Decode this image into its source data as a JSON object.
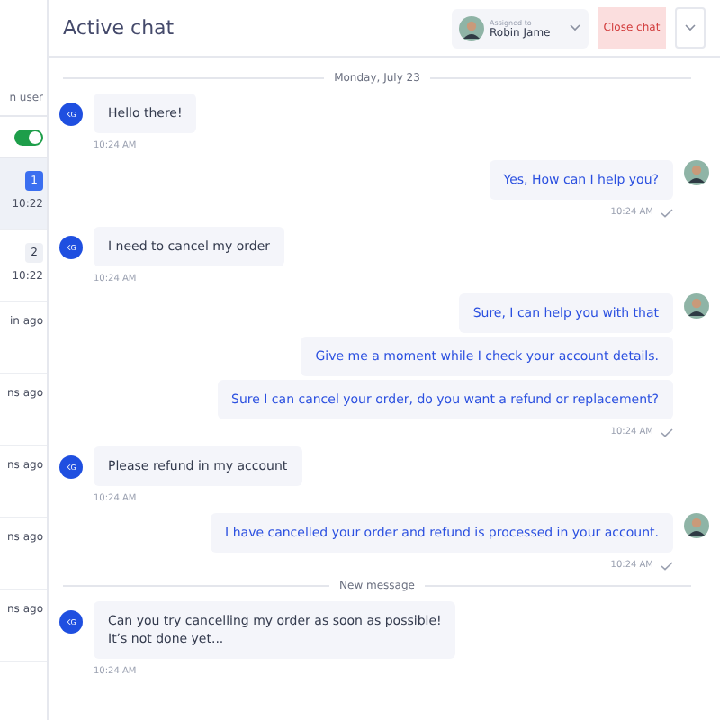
{
  "sidebar": {
    "filter_label": "n user",
    "toggle": {
      "on": true
    },
    "items": [
      {
        "badge": "1",
        "time": "10:22",
        "selected": true
      },
      {
        "badge": "2",
        "time": "10:22",
        "selected": false
      },
      {
        "time": "in ago",
        "selected": false
      },
      {
        "time": "ns ago",
        "selected": false
      },
      {
        "time": "ns ago",
        "selected": false
      },
      {
        "time": "ns ago",
        "selected": false
      },
      {
        "time": "ns ago",
        "selected": false
      }
    ]
  },
  "header": {
    "title": "Active chat",
    "assigned_label": "Assigned to",
    "assignee": "Robin Jame",
    "close_button": "Close chat"
  },
  "feed": [
    {
      "kind": "divider",
      "text": "Monday, July 23"
    },
    {
      "kind": "customer",
      "initials": "KG",
      "texts": [
        "Hello there!"
      ],
      "time": "10:24 AM"
    },
    {
      "kind": "agent",
      "texts": [
        "Yes, How can I help you?"
      ],
      "time": "10:24 AM",
      "read": true
    },
    {
      "kind": "customer",
      "initials": "KG",
      "texts": [
        "I need to cancel my order"
      ],
      "time": "10:24 AM"
    },
    {
      "kind": "agent",
      "texts": [
        "Sure, I can help you with that",
        "Give me a moment while I check your account details.",
        "Sure I can cancel your order, do you want a refund or replacement?"
      ],
      "time": "10:24 AM",
      "read": true
    },
    {
      "kind": "customer",
      "initials": "KG",
      "texts": [
        "Please refund in my account"
      ],
      "time": "10:24 AM"
    },
    {
      "kind": "agent",
      "texts": [
        "I have cancelled your order and refund is processed in your account."
      ],
      "time": "10:24 AM",
      "read": true
    },
    {
      "kind": "divider",
      "text": "New message"
    },
    {
      "kind": "customer",
      "initials": "KG",
      "texts": [
        "Can you try cancelling my order as soon as possible!\nIt’s not done yet..."
      ],
      "time": "10:24 AM"
    }
  ]
}
